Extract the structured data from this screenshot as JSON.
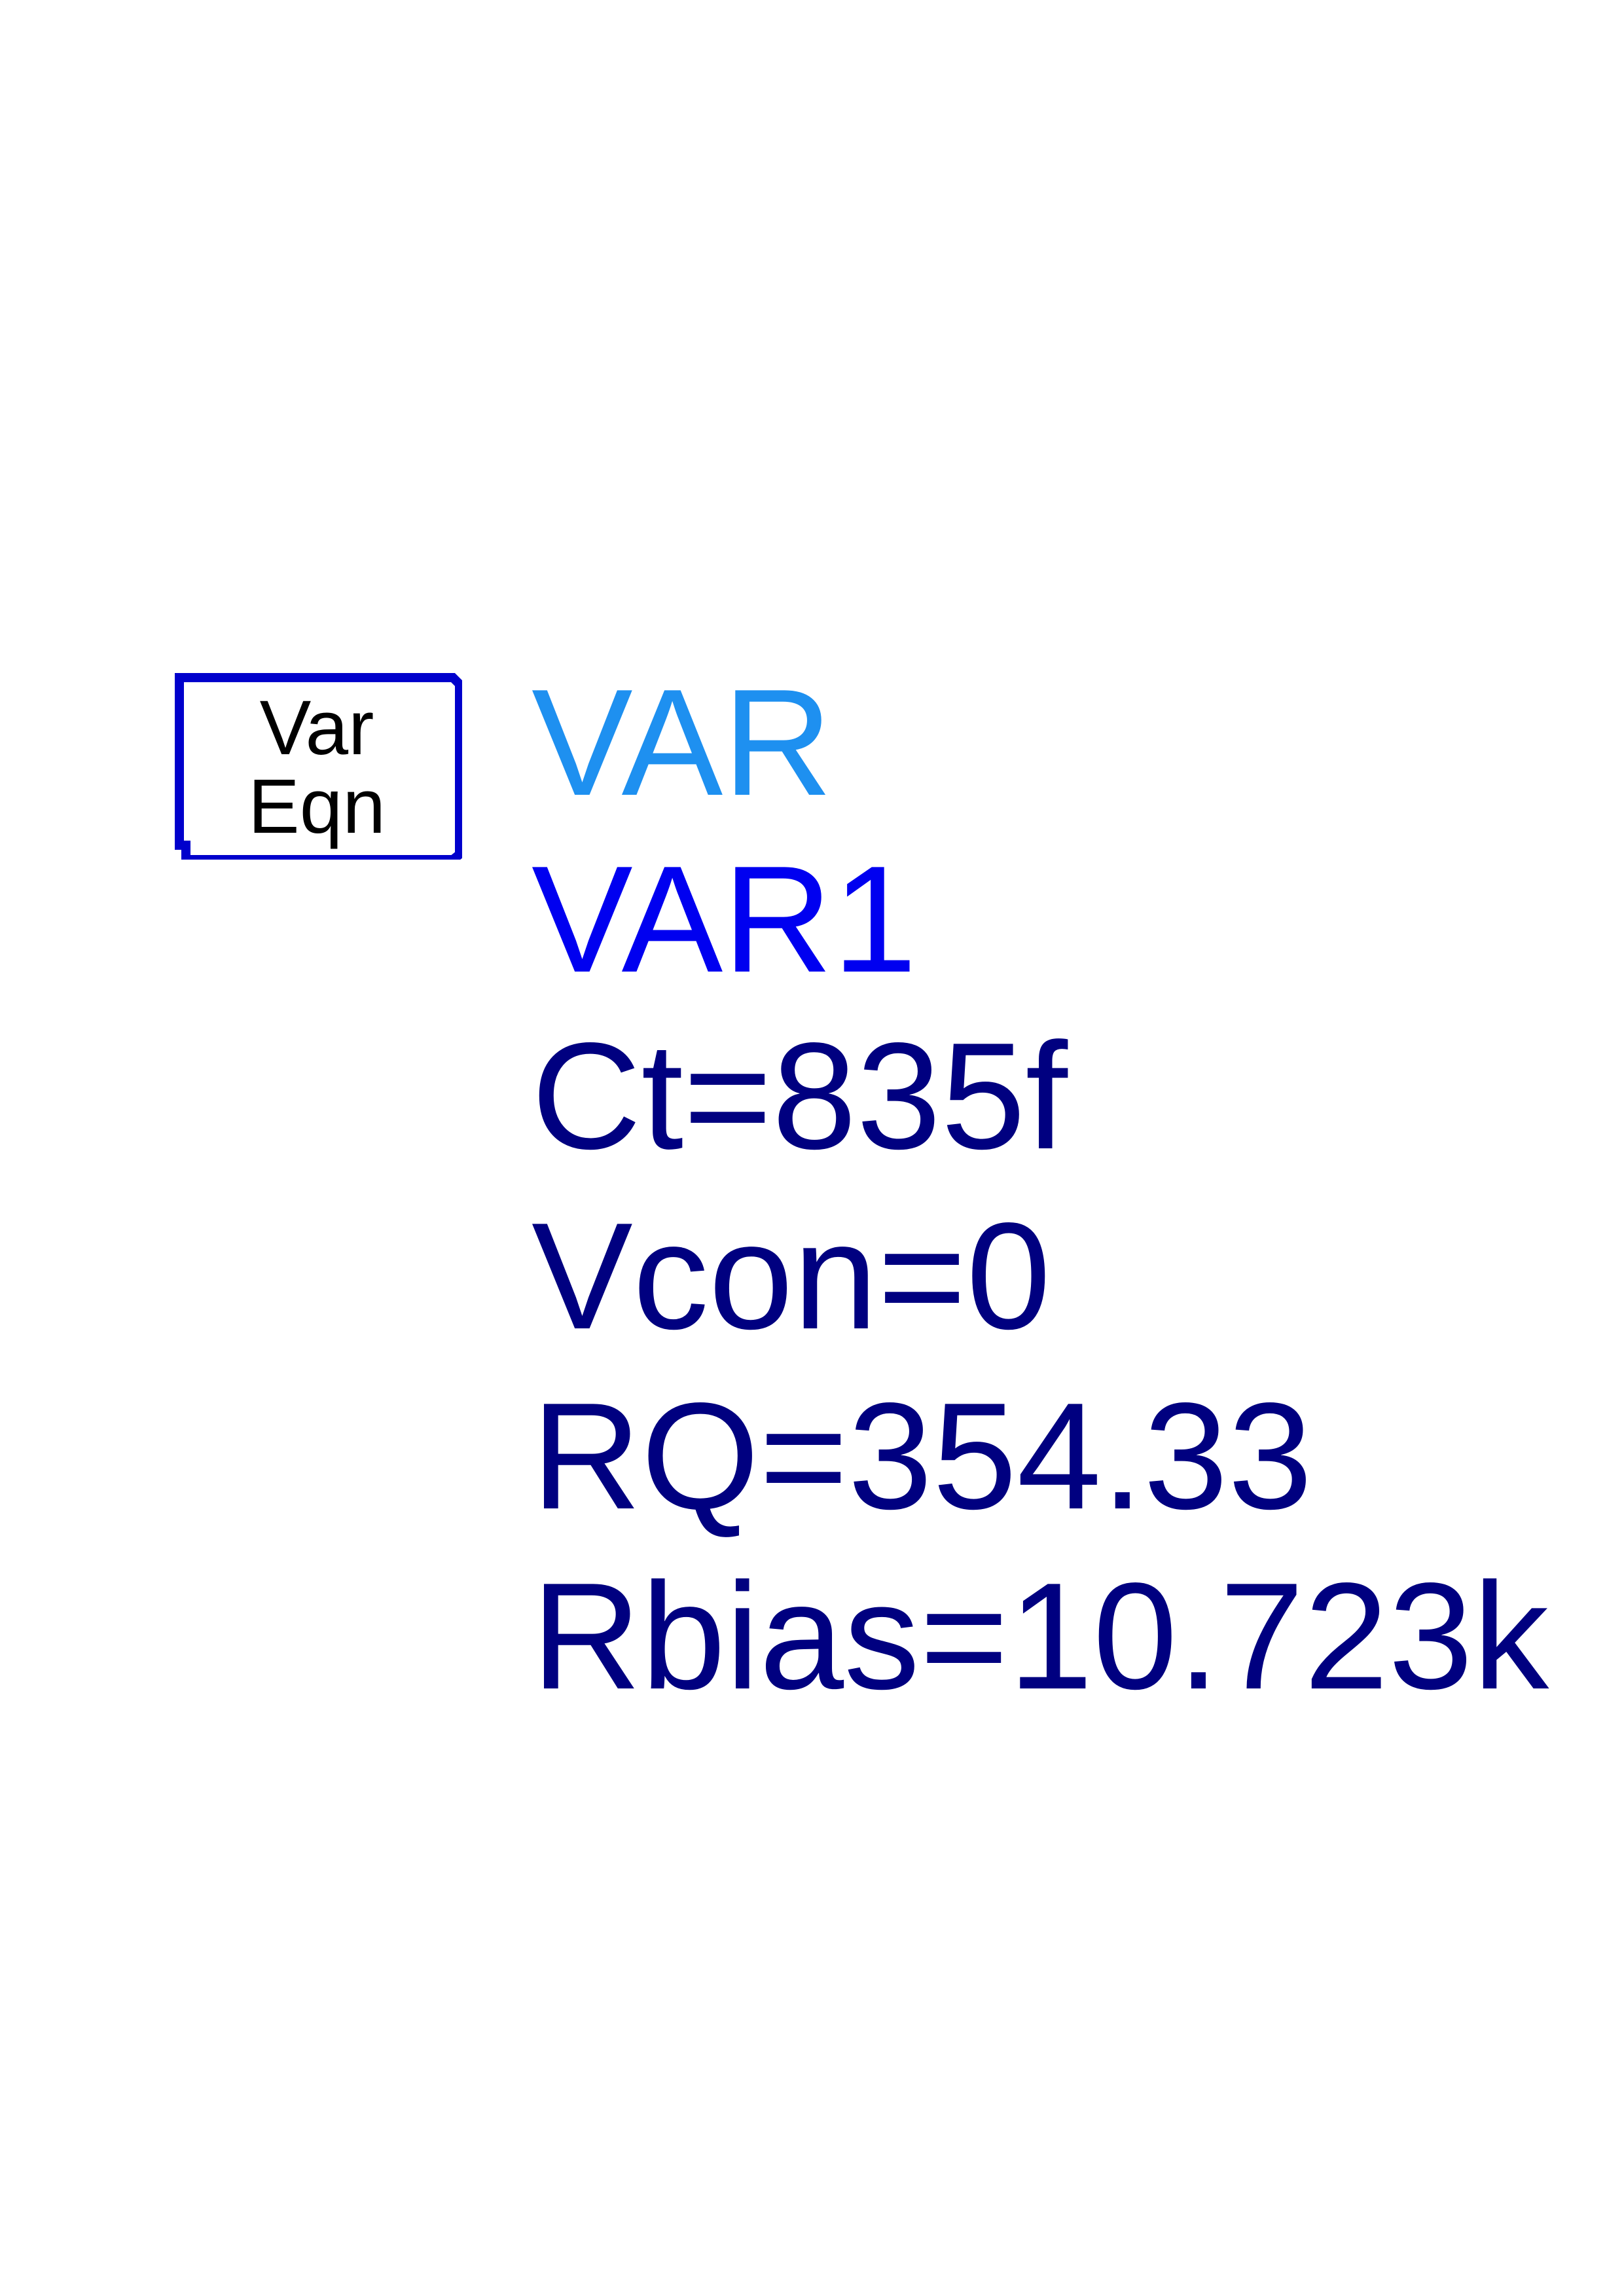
{
  "symbol": {
    "line1": "Var",
    "line2": "Eqn",
    "border_color": "#0000CC"
  },
  "component": {
    "type": "VAR",
    "type_color": "#1E90F0",
    "instance": "VAR1",
    "instance_color": "#0000F0",
    "parameter_color": "#000080"
  },
  "parameters": [
    "Ct=835f",
    "Vcon=0",
    "RQ=354.33",
    "Rbias=10.723k"
  ]
}
